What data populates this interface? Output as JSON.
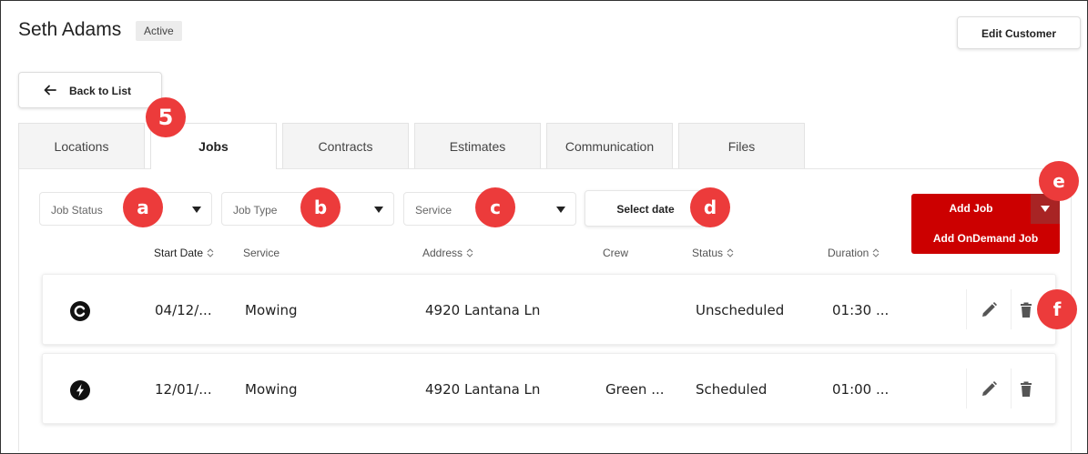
{
  "customer": {
    "name": "Seth Adams",
    "status": "Active",
    "edit_label": "Edit Customer",
    "back_label": "Back to List"
  },
  "tabs": [
    {
      "label": "Locations",
      "active": false
    },
    {
      "label": "Jobs",
      "active": true
    },
    {
      "label": "Contracts",
      "active": false
    },
    {
      "label": "Estimates",
      "active": false
    },
    {
      "label": "Communication",
      "active": false
    },
    {
      "label": "Files",
      "active": false
    }
  ],
  "filters": {
    "job_status": "Job Status",
    "job_type": "Job Type",
    "service": "Service",
    "date": "Select date"
  },
  "actions": {
    "add_job": "Add Job",
    "add_ondemand": "Add OnDemand Job"
  },
  "columns": {
    "start_date": "Start Date",
    "service": "Service",
    "address": "Address",
    "crew": "Crew",
    "status": "Status",
    "duration": "Duration"
  },
  "rows": [
    {
      "icon": "recurring-c-icon",
      "start_date": "04/12/...",
      "service": "Mowing",
      "address": "4920 Lantana Ln",
      "crew": "",
      "status": "Unscheduled",
      "duration": "01:30 ..."
    },
    {
      "icon": "ondemand-bolt-icon",
      "start_date": "12/01/...",
      "service": "Mowing",
      "address": "4920 Lantana Ln",
      "crew": "Green ...",
      "status": "Scheduled",
      "duration": "01:00 ..."
    }
  ],
  "markers": {
    "step": "5",
    "a": "a",
    "b": "b",
    "c": "c",
    "d": "d",
    "e": "e",
    "f": "f"
  },
  "colors": {
    "accent_red": "#cc0000",
    "marker_red": "#ec3b3b"
  }
}
